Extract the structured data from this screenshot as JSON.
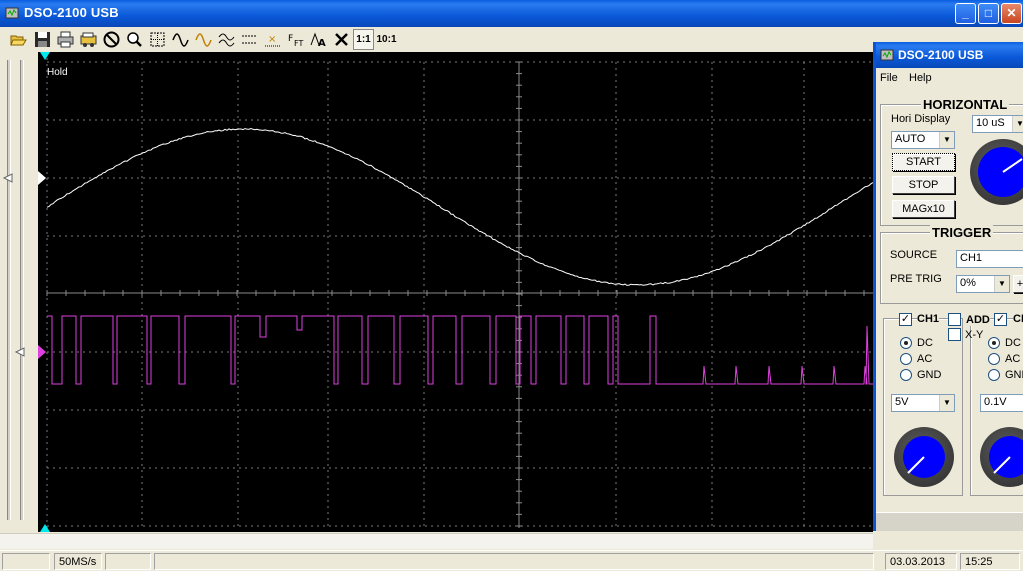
{
  "window": {
    "title": "DSO-2100 USB",
    "min": "_",
    "max": "□",
    "close": "✕"
  },
  "scope": {
    "status": "Hold"
  },
  "statusbar": {
    "cells": [
      "",
      "50MS/s",
      "",
      "",
      "03.03.2013",
      "15:25"
    ]
  },
  "toolbar": {
    "ratio1": "1:1",
    "ratio10": "10:1"
  },
  "panel": {
    "title": "DSO-2100 USB",
    "menu": {
      "file": "File",
      "help": "Help"
    },
    "horizontal": {
      "title": "HORIZONTAL",
      "hori_display_label": "Hori Display",
      "timebase": "10 uS",
      "mode": "AUTO",
      "start": "START",
      "stop": "STOP",
      "mag": "MAGx10"
    },
    "trigger": {
      "title": "TRIGGER",
      "source_label": "SOURCE",
      "source": "CH1",
      "pretrig_label": "PRE TRIG",
      "pretrig": "0%",
      "plus": "+"
    },
    "channels": {
      "ch1": "CH1",
      "add": "ADD",
      "ch2": "CH",
      "xy": "X-Y",
      "dc": "DC",
      "ac": "AC",
      "gnd": "GND",
      "ch1_volts": "5V",
      "ch2_volts": "0.1V"
    }
  },
  "colors": {
    "ch1_trace": "#FFFFFF",
    "ch2_trace": "#E040E0",
    "grid": "#808080",
    "marker": "#00FFFF"
  }
}
